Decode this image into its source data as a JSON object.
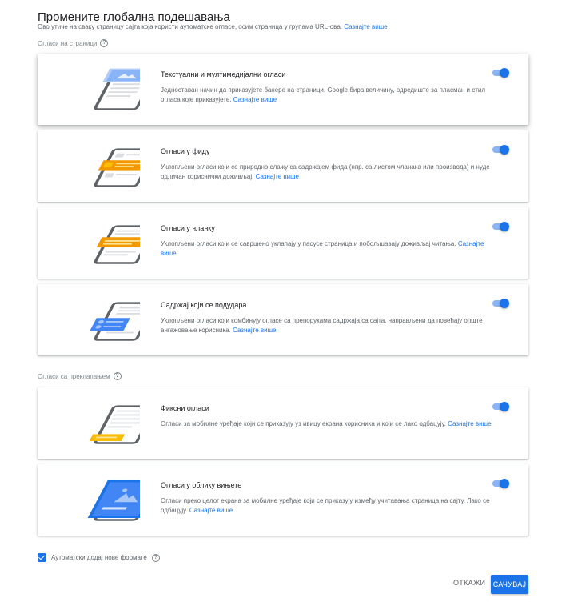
{
  "header": {
    "title": "Промените глобална подешавања",
    "subtitle": "Ово утиче на сваку страницу сајта која користи аутоматске огласе, осим страница у групама URL-ова.",
    "learn_more": "Сазнајте више"
  },
  "sections": {
    "in_page": {
      "label": "Огласи на страници"
    },
    "overlay": {
      "label": "Огласи са преклапањем"
    }
  },
  "cards": [
    {
      "title": "Текстуални и мултимедијални огласи",
      "desc": "Једноставан начин да приказујете банере на страници. Google бира величину, одредиште за пласман и стил огласа које приказујете.",
      "link": "Сазнајте више",
      "enabled": true
    },
    {
      "title": "Огласи у фиду",
      "desc": "Уклопљени огласи који се природно слажу са садржајем фида (нпр. са листом чланака или производа) и нуде одличан кориснички доживљај.",
      "link": "Сазнајте више",
      "enabled": true
    },
    {
      "title": "Огласи у чланку",
      "desc": "Уклопљени огласи који се савршено уклапају у пасусе страница и побољшавају доживљај читања.",
      "link": "Сазнајте више",
      "enabled": true
    },
    {
      "title": "Садржај који се подудара",
      "desc": "Уклопљени огласи који комбинују огласе са препорукама садржаја са сајта, направљени да повећају опште ангажовање корисника.",
      "link": "Сазнајте више",
      "enabled": true
    },
    {
      "title": "Фиксни огласи",
      "desc": "Огласи за мобилне уређаје који се приказују уз ивицу екрана корисника и који се лако одбацују.",
      "link": "Сазнајте више",
      "enabled": true
    },
    {
      "title": "Огласи у облику вињете",
      "desc": "Огласи преко целог екрана за мобилне уређаје који се приказују између учитавања страница на сајту. Лако се одбацују.",
      "link": "Сазнајте више",
      "enabled": true
    }
  ],
  "footer": {
    "auto_add_label": "Аутоматски додај нове формате",
    "auto_add_checked": true,
    "cancel_label": "ОТКАЖИ",
    "save_label": "САЧУВАЈ"
  },
  "colors": {
    "accent": "#1a73e8",
    "illus_blue": "#4285f4",
    "illus_orange": "#f29900"
  }
}
